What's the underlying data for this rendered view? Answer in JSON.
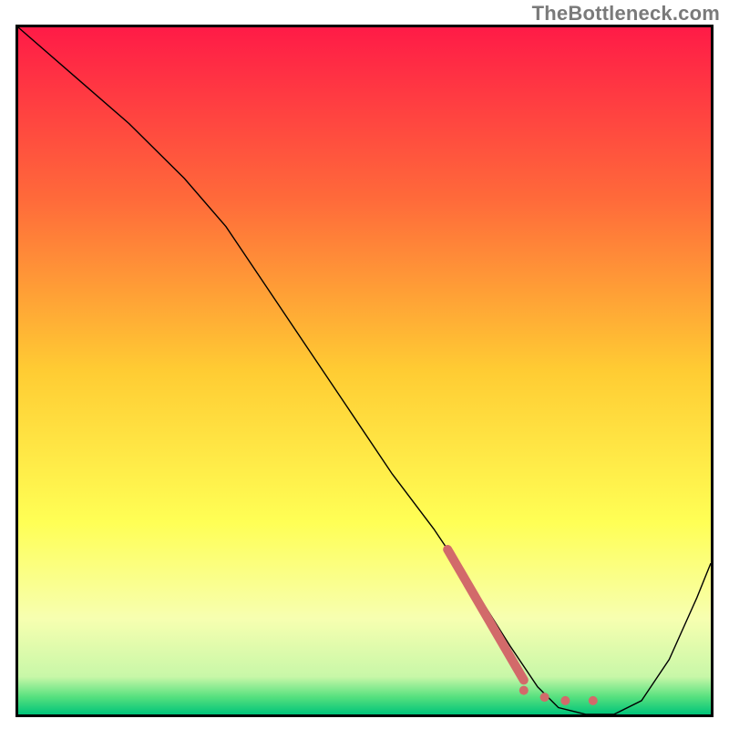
{
  "watermark": "TheBottleneck.com",
  "chart_data": {
    "type": "line",
    "title": "",
    "xlabel": "",
    "ylabel": "",
    "xlim": [
      0,
      100
    ],
    "ylim": [
      0,
      100
    ],
    "series": [
      {
        "name": "bottleneck-curve",
        "stroke": "#000000",
        "stroke_width": 1.4,
        "x": [
          0,
          8,
          16,
          24,
          30,
          36,
          42,
          48,
          54,
          60,
          66,
          71,
          75,
          78,
          82,
          86,
          90,
          94,
          98,
          100
        ],
        "y": [
          100,
          93,
          86,
          78,
          71,
          62,
          53,
          44,
          35,
          27,
          18,
          10,
          4,
          1,
          0,
          0,
          2,
          8,
          17,
          22
        ]
      }
    ],
    "highlight": {
      "name": "suggested-range",
      "color": "#d26a6a",
      "stroke_width": 10,
      "segment": {
        "x": [
          62,
          73
        ],
        "y": [
          24,
          5
        ]
      },
      "dots": [
        {
          "x": 73,
          "y": 3.5
        },
        {
          "x": 76,
          "y": 2.5
        },
        {
          "x": 79,
          "y": 2.0
        },
        {
          "x": 83,
          "y": 2.0
        }
      ]
    },
    "background_gradient": {
      "stops": [
        {
          "pos": 0.0,
          "color": "#ff1b47"
        },
        {
          "pos": 0.25,
          "color": "#ff6a3a"
        },
        {
          "pos": 0.5,
          "color": "#ffcc33"
        },
        {
          "pos": 0.72,
          "color": "#ffff55"
        },
        {
          "pos": 0.86,
          "color": "#f7ffb0"
        },
        {
          "pos": 0.945,
          "color": "#c8f7a8"
        },
        {
          "pos": 0.975,
          "color": "#55e07e"
        },
        {
          "pos": 1.0,
          "color": "#00c47a"
        }
      ]
    },
    "frame_color": "#000000"
  }
}
